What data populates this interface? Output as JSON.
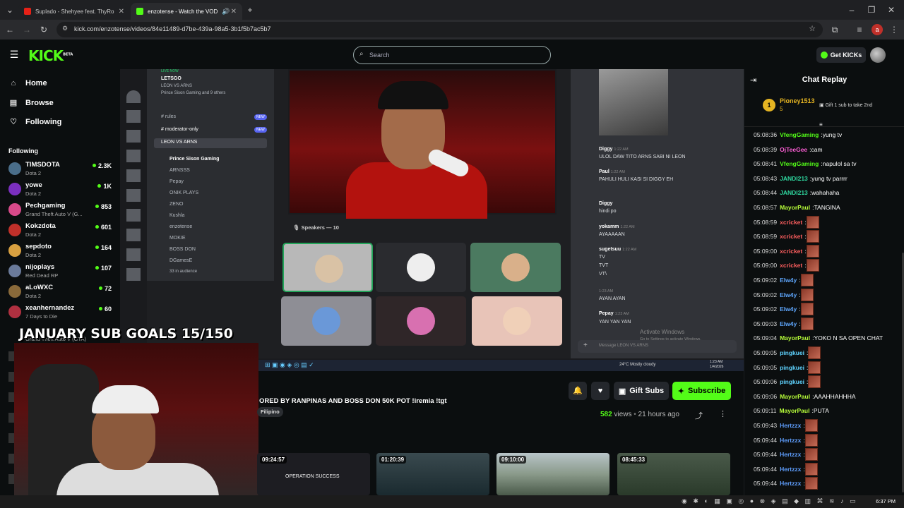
{
  "browser": {
    "tabs": [
      {
        "title": "Suplado - Shehyee feat. ThyRo",
        "active": false
      },
      {
        "title": "enzotense - Watch the VOD",
        "active": true
      }
    ],
    "url": "kick.com/enzotense/videos/84e11489-d7be-439a-98a5-3b1f5b7ac5b7",
    "profile_letter": "a"
  },
  "header": {
    "logo": "KICK",
    "logo_sup": "BETA",
    "search_placeholder": "Search",
    "get_kicks": "Get KICKs"
  },
  "sidebar": {
    "nav": [
      {
        "label": "Home",
        "icon": "home-icon"
      },
      {
        "label": "Browse",
        "icon": "browse-icon"
      },
      {
        "label": "Following",
        "icon": "heart-icon"
      }
    ],
    "following_title": "Following",
    "channels": [
      {
        "name": "TIMSDOTA",
        "game": "Dota 2",
        "viewers": "2.3K",
        "color": "#4a6e8a"
      },
      {
        "name": "yowe",
        "game": "Dota 2",
        "viewers": "1K",
        "color": "#7b2fbf"
      },
      {
        "name": "Pechgaming",
        "game": "Grand Theft Auto V (G...",
        "viewers": "853",
        "color": "#d94a8a"
      },
      {
        "name": "Kokzdota",
        "game": "Dota 2",
        "viewers": "601",
        "color": "#c0302a"
      },
      {
        "name": "sepdoto",
        "game": "Dota 2",
        "viewers": "164",
        "color": "#d8a040"
      },
      {
        "name": "nijoplays",
        "game": "Red Dead RP",
        "viewers": "107",
        "color": "#6a7a9a"
      },
      {
        "name": "aLoWXC",
        "game": "Dota 2",
        "viewers": "72",
        "color": "#8a6a3a"
      },
      {
        "name": "xeanhernandez",
        "game": "7 Days to Die",
        "viewers": "60",
        "color": "#b03040"
      }
    ],
    "partial_game": "Grand Theft Auto V (GTA)"
  },
  "overlay": {
    "goal_text": "JANUARY SUB GOALS 15/150"
  },
  "discord": {
    "live_label": "LIVE NOW",
    "letsgo": "LETSGO",
    "sub1": "LEON VS ARNS",
    "sub2": "Prince Sison Gaming and 9 others",
    "channels": [
      "rules",
      "moderator-only",
      "LEON VS ARNS"
    ],
    "new_badge": "NEW",
    "voice_users": [
      "Prince Sison Gaming",
      "ARNSSS",
      "Pepay",
      "ONIK PLAYS",
      "ZENO",
      "Kushla",
      "enzotense",
      "MOKIE",
      "BOSS DON",
      "DGamesE"
    ],
    "in_audience": "33 in audience",
    "speakers_label": "Speakers — 10",
    "messages": [
      {
        "user": "Diggy",
        "time": "1:22 AM",
        "text": "ULOL DAW TITO ARNS SABI NI LEON"
      },
      {
        "user": "Paul",
        "time": "1:22 AM",
        "text": "PAHULI HULI KASI SI DIGGY EH"
      },
      {
        "user": "Diggy",
        "time": "1:22 AM",
        "text": "hindi po"
      },
      {
        "user": "yokamm",
        "time": "1:22 AM",
        "text": "AYAAAAAN"
      },
      {
        "user": "sugetsuu",
        "time": "1:22 AM",
        "text": "TV"
      },
      {
        "user": "",
        "time": "",
        "text": "TVT"
      },
      {
        "user": "",
        "time": "",
        "text": "VT\\"
      },
      {
        "user": "",
        "time": "1:23 AM",
        "text": "AYAN AYAN"
      },
      {
        "user": "Pepay",
        "time": "1:23 AM",
        "text": "YAN YAN YAN"
      }
    ],
    "activate_title": "Activate Windows",
    "activate_sub": "Go to Settings to activate Windows.",
    "input_placeholder": "Message LEON VS ARNS",
    "weather": "24°C Mostly cloudy",
    "inner_time": "1:23 AM",
    "inner_date": "1/4/2026"
  },
  "video_meta": {
    "title": "ORED BY RANPINAS AND BOSS DON 50K POT !iremia !tgt",
    "language": "Filipino",
    "views": "582",
    "views_label": "views",
    "ago": "21 hours ago",
    "gift_subs": "Gift Subs",
    "subscribe": "Subscribe"
  },
  "thumbnails": [
    {
      "duration": "09:24:57",
      "caption": "OPERATION SUCCESS",
      "color": "#1d1d22"
    },
    {
      "duration": "01:20:39",
      "caption": "",
      "color": "#2a3a3f"
    },
    {
      "duration": "09:10:00",
      "caption": "",
      "color": "#6a7a6a"
    },
    {
      "duration": "08:45:33",
      "caption": "",
      "color": "#3a4a3a"
    }
  ],
  "chat": {
    "title": "Chat Replay",
    "pinned_user": "Pioney1513",
    "pinned_count": "5",
    "pinned_rank": "1",
    "pinned_cta": "Gift 1 sub to take 2nd",
    "messages": [
      {
        "time": "05:08:36",
        "user": "VfengGaming",
        "color": "#53fc18",
        "text": "yung tv",
        "emote": false
      },
      {
        "time": "05:08:39",
        "user": "OjTeeGee",
        "color": "#ff5fd7",
        "text": "cam",
        "emote": false
      },
      {
        "time": "05:08:41",
        "user": "VfengGaming",
        "color": "#53fc18",
        "text": "napulol sa tv",
        "emote": false
      },
      {
        "time": "05:08:43",
        "user": "JANDI213",
        "color": "#2fd9a0",
        "text": "yung tv parrrr",
        "emote": false
      },
      {
        "time": "05:08:44",
        "user": "JANDI213",
        "color": "#2fd9a0",
        "text": "wahahaha",
        "emote": false
      },
      {
        "time": "05:08:57",
        "user": "MayorPaul",
        "color": "#b8ff3a",
        "text": "TANGINA",
        "emote": false
      },
      {
        "time": "05:08:59",
        "user": "xcricket",
        "color": "#ff5f5f",
        "text": "",
        "emote": true
      },
      {
        "time": "05:08:59",
        "user": "xcricket",
        "color": "#ff5f5f",
        "text": "",
        "emote": true
      },
      {
        "time": "05:09:00",
        "user": "xcricket",
        "color": "#ff5f5f",
        "text": "",
        "emote": true
      },
      {
        "time": "05:09:00",
        "user": "xcricket",
        "color": "#ff5f5f",
        "text": "",
        "emote": true
      },
      {
        "time": "05:09:02",
        "user": "Elw4y",
        "color": "#5fa8ff",
        "text": "",
        "emote": true
      },
      {
        "time": "05:09:02",
        "user": "Elw4y",
        "color": "#5fa8ff",
        "text": "",
        "emote": true
      },
      {
        "time": "05:09:02",
        "user": "Elw4y",
        "color": "#5fa8ff",
        "text": "",
        "emote": true
      },
      {
        "time": "05:09:03",
        "user": "Elw4y",
        "color": "#5fa8ff",
        "text": "",
        "emote": true
      },
      {
        "time": "05:09:04",
        "user": "MayorPaul",
        "color": "#b8ff3a",
        "text": "YOKO N SA OPEN CHAT",
        "emote": false
      },
      {
        "time": "05:09:05",
        "user": "pingkuei",
        "color": "#5fd3ff",
        "text": "",
        "emote": true
      },
      {
        "time": "05:09:05",
        "user": "pingkuei",
        "color": "#5fd3ff",
        "text": "",
        "emote": true
      },
      {
        "time": "05:09:06",
        "user": "pingkuei",
        "color": "#5fd3ff",
        "text": "",
        "emote": true
      },
      {
        "time": "05:09:06",
        "user": "MayorPaul",
        "color": "#b8ff3a",
        "text": "AAAHHAHHHA",
        "emote": false
      },
      {
        "time": "05:09:11",
        "user": "MayorPaul",
        "color": "#b8ff3a",
        "text": "PUTA",
        "emote": false
      },
      {
        "time": "05:09:43",
        "user": "Hertzzx",
        "color": "#5f9fff",
        "text": "",
        "emote": true
      },
      {
        "time": "05:09:44",
        "user": "Hertzzx",
        "color": "#5f9fff",
        "text": "",
        "emote": true
      },
      {
        "time": "05:09:44",
        "user": "Hertzzx",
        "color": "#5f9fff",
        "text": "",
        "emote": true
      },
      {
        "time": "05:09:44",
        "user": "Hertzzx",
        "color": "#5f9fff",
        "text": "",
        "emote": true
      },
      {
        "time": "05:09:44",
        "user": "Hertzzx",
        "color": "#5f9fff",
        "text": "",
        "emote": true
      }
    ]
  },
  "os": {
    "time": "6:37 PM"
  },
  "colors": {
    "accent": "#53fc18",
    "background": "#0b0e0f"
  }
}
